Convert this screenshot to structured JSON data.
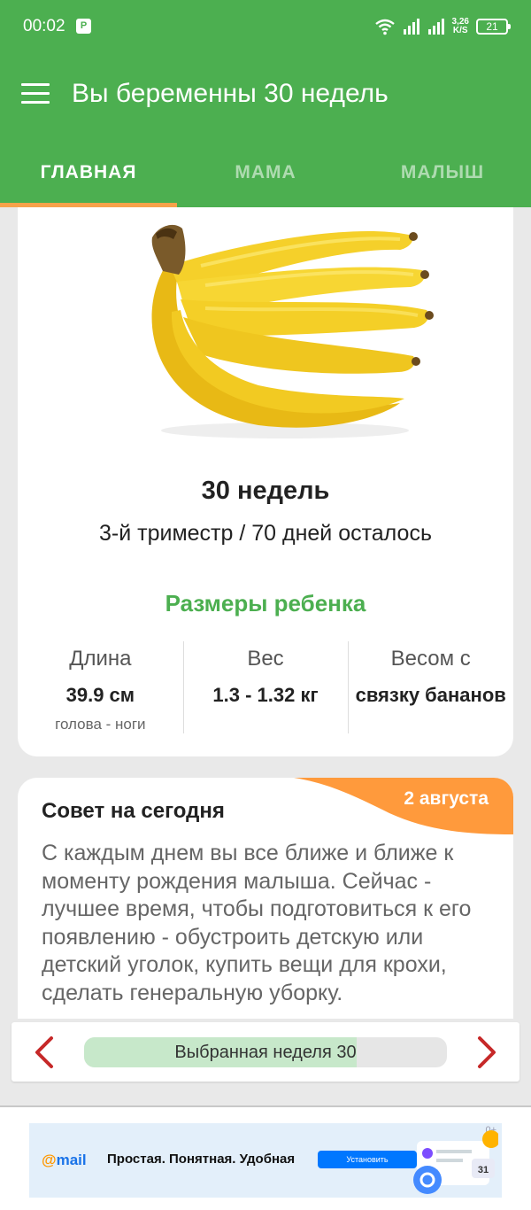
{
  "status_bar": {
    "time": "00:02",
    "app_badge": "P",
    "speed_value": "3,26",
    "speed_unit": "K/S",
    "battery": "21"
  },
  "app_bar": {
    "title": "Вы беременны 30 недель"
  },
  "tabs": [
    {
      "label": "ГЛАВНАЯ",
      "active": true
    },
    {
      "label": "МАМА",
      "active": false
    },
    {
      "label": "МАЛЫШ",
      "active": false
    }
  ],
  "week_card": {
    "image_icon": "banana-bunch-icon",
    "title": "30 недель",
    "subtitle": "3-й триместр / 70 дней осталось",
    "sizes_title": "Размеры ребенка",
    "stats": [
      {
        "label": "Длина",
        "value": "39.9 см",
        "note": "голова - ноги"
      },
      {
        "label": "Вес",
        "value": "1.3 - 1.32 кг",
        "note": ""
      },
      {
        "label": "Весом с",
        "value": "связку бананов",
        "note": ""
      }
    ]
  },
  "tip_card": {
    "date": "2 августа",
    "title": "Совет на сегодня",
    "text": "С каждым днем вы все ближе и ближе к моменту рождения малыша. Сейчас - лучшее время, чтобы подготовиться к его появлению - обустроить детскую или детский уголок, купить вещи для крохи, сделать генеральную уборку."
  },
  "week_selector": {
    "label": "Выбранная неделя 30",
    "progress_fraction": 0.75,
    "prev_icon": "chevron-left-icon",
    "next_icon": "chevron-right-icon"
  },
  "ad": {
    "logo_at": "@",
    "logo_text": "mail",
    "text": "Простая. Понятная. Удобная",
    "button": "Установить",
    "badge": "0+",
    "calendar_day": "31"
  },
  "colors": {
    "primary": "#4caf50",
    "accent": "#f7a24a",
    "tip_corner": "#ff9a3c",
    "arrow": "#c62828"
  }
}
